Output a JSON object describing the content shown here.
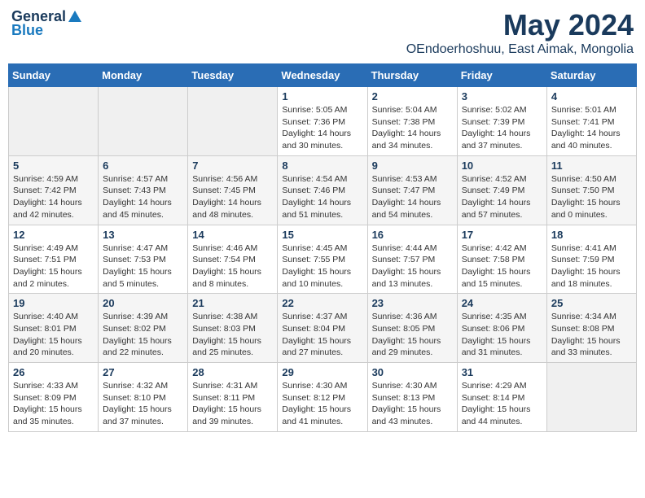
{
  "logo": {
    "general": "General",
    "blue": "Blue"
  },
  "title": "May 2024",
  "subtitle": "OEndoerhoshuu, East Aimak, Mongolia",
  "days_header": [
    "Sunday",
    "Monday",
    "Tuesday",
    "Wednesday",
    "Thursday",
    "Friday",
    "Saturday"
  ],
  "weeks": [
    [
      {
        "day": "",
        "info": ""
      },
      {
        "day": "",
        "info": ""
      },
      {
        "day": "",
        "info": ""
      },
      {
        "day": "1",
        "info": "Sunrise: 5:05 AM\nSunset: 7:36 PM\nDaylight: 14 hours\nand 30 minutes."
      },
      {
        "day": "2",
        "info": "Sunrise: 5:04 AM\nSunset: 7:38 PM\nDaylight: 14 hours\nand 34 minutes."
      },
      {
        "day": "3",
        "info": "Sunrise: 5:02 AM\nSunset: 7:39 PM\nDaylight: 14 hours\nand 37 minutes."
      },
      {
        "day": "4",
        "info": "Sunrise: 5:01 AM\nSunset: 7:41 PM\nDaylight: 14 hours\nand 40 minutes."
      }
    ],
    [
      {
        "day": "5",
        "info": "Sunrise: 4:59 AM\nSunset: 7:42 PM\nDaylight: 14 hours\nand 42 minutes."
      },
      {
        "day": "6",
        "info": "Sunrise: 4:57 AM\nSunset: 7:43 PM\nDaylight: 14 hours\nand 45 minutes."
      },
      {
        "day": "7",
        "info": "Sunrise: 4:56 AM\nSunset: 7:45 PM\nDaylight: 14 hours\nand 48 minutes."
      },
      {
        "day": "8",
        "info": "Sunrise: 4:54 AM\nSunset: 7:46 PM\nDaylight: 14 hours\nand 51 minutes."
      },
      {
        "day": "9",
        "info": "Sunrise: 4:53 AM\nSunset: 7:47 PM\nDaylight: 14 hours\nand 54 minutes."
      },
      {
        "day": "10",
        "info": "Sunrise: 4:52 AM\nSunset: 7:49 PM\nDaylight: 14 hours\nand 57 minutes."
      },
      {
        "day": "11",
        "info": "Sunrise: 4:50 AM\nSunset: 7:50 PM\nDaylight: 15 hours\nand 0 minutes."
      }
    ],
    [
      {
        "day": "12",
        "info": "Sunrise: 4:49 AM\nSunset: 7:51 PM\nDaylight: 15 hours\nand 2 minutes."
      },
      {
        "day": "13",
        "info": "Sunrise: 4:47 AM\nSunset: 7:53 PM\nDaylight: 15 hours\nand 5 minutes."
      },
      {
        "day": "14",
        "info": "Sunrise: 4:46 AM\nSunset: 7:54 PM\nDaylight: 15 hours\nand 8 minutes."
      },
      {
        "day": "15",
        "info": "Sunrise: 4:45 AM\nSunset: 7:55 PM\nDaylight: 15 hours\nand 10 minutes."
      },
      {
        "day": "16",
        "info": "Sunrise: 4:44 AM\nSunset: 7:57 PM\nDaylight: 15 hours\nand 13 minutes."
      },
      {
        "day": "17",
        "info": "Sunrise: 4:42 AM\nSunset: 7:58 PM\nDaylight: 15 hours\nand 15 minutes."
      },
      {
        "day": "18",
        "info": "Sunrise: 4:41 AM\nSunset: 7:59 PM\nDaylight: 15 hours\nand 18 minutes."
      }
    ],
    [
      {
        "day": "19",
        "info": "Sunrise: 4:40 AM\nSunset: 8:01 PM\nDaylight: 15 hours\nand 20 minutes."
      },
      {
        "day": "20",
        "info": "Sunrise: 4:39 AM\nSunset: 8:02 PM\nDaylight: 15 hours\nand 22 minutes."
      },
      {
        "day": "21",
        "info": "Sunrise: 4:38 AM\nSunset: 8:03 PM\nDaylight: 15 hours\nand 25 minutes."
      },
      {
        "day": "22",
        "info": "Sunrise: 4:37 AM\nSunset: 8:04 PM\nDaylight: 15 hours\nand 27 minutes."
      },
      {
        "day": "23",
        "info": "Sunrise: 4:36 AM\nSunset: 8:05 PM\nDaylight: 15 hours\nand 29 minutes."
      },
      {
        "day": "24",
        "info": "Sunrise: 4:35 AM\nSunset: 8:06 PM\nDaylight: 15 hours\nand 31 minutes."
      },
      {
        "day": "25",
        "info": "Sunrise: 4:34 AM\nSunset: 8:08 PM\nDaylight: 15 hours\nand 33 minutes."
      }
    ],
    [
      {
        "day": "26",
        "info": "Sunrise: 4:33 AM\nSunset: 8:09 PM\nDaylight: 15 hours\nand 35 minutes."
      },
      {
        "day": "27",
        "info": "Sunrise: 4:32 AM\nSunset: 8:10 PM\nDaylight: 15 hours\nand 37 minutes."
      },
      {
        "day": "28",
        "info": "Sunrise: 4:31 AM\nSunset: 8:11 PM\nDaylight: 15 hours\nand 39 minutes."
      },
      {
        "day": "29",
        "info": "Sunrise: 4:30 AM\nSunset: 8:12 PM\nDaylight: 15 hours\nand 41 minutes."
      },
      {
        "day": "30",
        "info": "Sunrise: 4:30 AM\nSunset: 8:13 PM\nDaylight: 15 hours\nand 43 minutes."
      },
      {
        "day": "31",
        "info": "Sunrise: 4:29 AM\nSunset: 8:14 PM\nDaylight: 15 hours\nand 44 minutes."
      },
      {
        "day": "",
        "info": ""
      }
    ]
  ]
}
